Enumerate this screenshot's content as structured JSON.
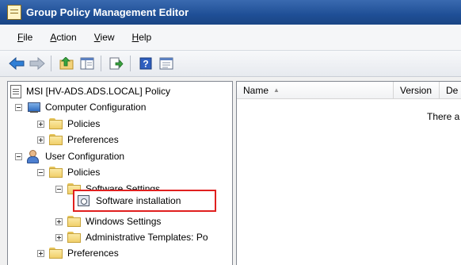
{
  "window": {
    "title": "Group Policy Management Editor"
  },
  "menu": [
    {
      "label_ul": "F",
      "label_rest": "ile"
    },
    {
      "label_ul": "A",
      "label_rest": "ction"
    },
    {
      "label_ul": "V",
      "label_rest": "iew"
    },
    {
      "label_ul": "H",
      "label_rest": "elp"
    }
  ],
  "toolbar": {
    "buttons": [
      "back-icon",
      "forward-icon",
      "up-folder-icon",
      "show-hide-tree-icon",
      "export-list-icon",
      "help-icon",
      "properties-icon"
    ]
  },
  "tree": {
    "root": "MSI [HV-ADS.ADS.LOCAL] Policy",
    "computer_configuration": "Computer Configuration",
    "cc_policies": "Policies",
    "cc_preferences": "Preferences",
    "user_configuration": "User Configuration",
    "uc_policies": "Policies",
    "software_settings": "Software Settings",
    "software_installation": "Software installation",
    "windows_settings": "Windows Settings",
    "administrative_templates": "Administrative Templates: Po",
    "uc_preferences": "Preferences"
  },
  "list": {
    "columns": [
      "Name",
      "Version",
      "De"
    ],
    "empty_message": "There a"
  },
  "colors": {
    "titlebar": "#1f4f96",
    "highlight": "#e0201f"
  }
}
